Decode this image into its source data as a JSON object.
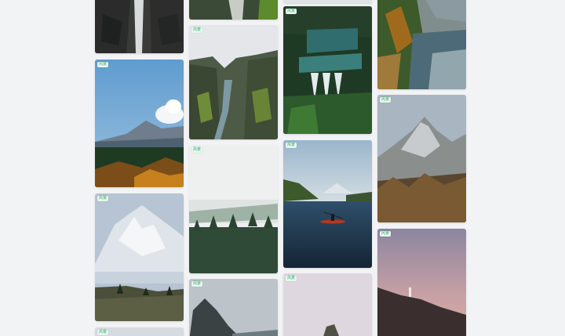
{
  "gallery": {
    "cards": [
      {
        "id": "c1",
        "badge": "",
        "subject": "waterfall-canyon"
      },
      {
        "id": "c2",
        "badge": "风景",
        "subject": "mountain-lake-sunny"
      },
      {
        "id": "c3",
        "badge": "风景",
        "subject": "snowy-peak"
      },
      {
        "id": "c4",
        "badge": "风景",
        "subject": "partial-bottom"
      },
      {
        "id": "c5",
        "badge": "",
        "subject": "waterfall-top"
      },
      {
        "id": "c6",
        "badge": "风景",
        "subject": "gorge-river"
      },
      {
        "id": "c7",
        "badge": "风景",
        "subject": "misty-forest"
      },
      {
        "id": "c8",
        "badge": "风景",
        "subject": "foggy-cliffs"
      },
      {
        "id": "c9",
        "badge": "",
        "subject": "lake-top"
      },
      {
        "id": "c10",
        "badge": "风景",
        "subject": "cascading-falls"
      },
      {
        "id": "c11",
        "badge": "风景",
        "subject": "kayak-lake"
      },
      {
        "id": "c12",
        "badge": "风景",
        "subject": "pink-sky-rock"
      },
      {
        "id": "c13",
        "badge": "",
        "subject": "autumn-lake"
      },
      {
        "id": "c14",
        "badge": "风景",
        "subject": "rocky-mountain"
      },
      {
        "id": "c15",
        "badge": "风景",
        "subject": "dusk-lighthouse"
      }
    ]
  },
  "colors": {
    "background": "#f2f3f5",
    "badge_bg": "#e9f7ee",
    "badge_text": "#2fa86a"
  }
}
